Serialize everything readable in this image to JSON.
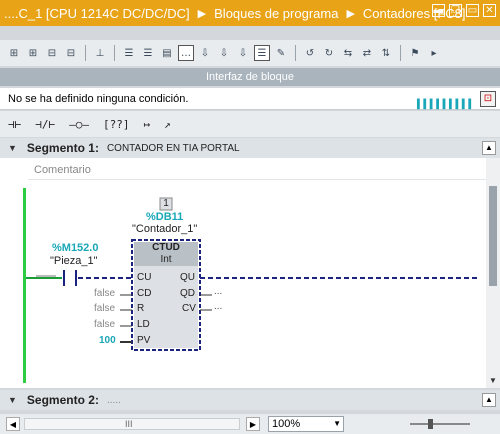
{
  "title": {
    "breadcrumb": [
      "....C_1 [CPU 1214C DC/DC/DC]",
      "Bloques de programa",
      "Contadores [FC8]"
    ],
    "window_buttons": [
      "▬",
      "❐",
      "▭",
      "✕"
    ]
  },
  "toolbar": {
    "icons": [
      "network-icon",
      "network-icon",
      "network-icon",
      "network-icon",
      "pin-icon",
      "list-icon",
      "list-icon",
      "list-icon",
      "comment-icon",
      "download-icon",
      "download-icon",
      "download-icon",
      "list-icon",
      "edit-icon",
      "go-icon",
      "go-icon",
      "go-icon",
      "go-icon",
      "go-icon",
      "flag-icon",
      "more-icon"
    ]
  },
  "interface_bar": {
    "label": "Interfaz de bloque"
  },
  "condition_bar": {
    "text": "No se ha definido ninguna condición.",
    "indicator": "▐▐▐▐▐▐▐▐▐"
  },
  "ladder_bar": {
    "items": [
      "⊣⊢",
      "⊣/⊢",
      "–○–",
      "[??]",
      "↦",
      "↗"
    ]
  },
  "segment1": {
    "arrow": "▼",
    "title": "Segmento 1:",
    "name": "CONTADOR EN TIA PORTAL",
    "comment": "Comentario"
  },
  "segment2": {
    "arrow": "▼",
    "title": "Segmento 2:",
    "comment": "....."
  },
  "block": {
    "number": "1",
    "db": "%DB11",
    "instance": "\"Contador_1\"",
    "type": "CTUD",
    "datatype": "Int",
    "inputs": [
      "CU",
      "CD",
      "R",
      "LD",
      "PV"
    ],
    "outputs": [
      "QU",
      "QD",
      "CV"
    ],
    "input_values": [
      "",
      "false",
      "false",
      "false",
      "100"
    ],
    "output_values": [
      "",
      "...",
      "..."
    ]
  },
  "contact": {
    "address": "%M152.0",
    "tag": "\"Pieza_1\""
  },
  "statusbar": {
    "zoom": "100%",
    "scroll_grip": "III",
    "left_arrow": "◀",
    "right_arrow": "▶"
  },
  "colors": {
    "title_bg": "#e8a317",
    "accent_teal": "#1aa7b8",
    "wire_blue": "#1a237e",
    "rail_green": "#2ecc40"
  }
}
